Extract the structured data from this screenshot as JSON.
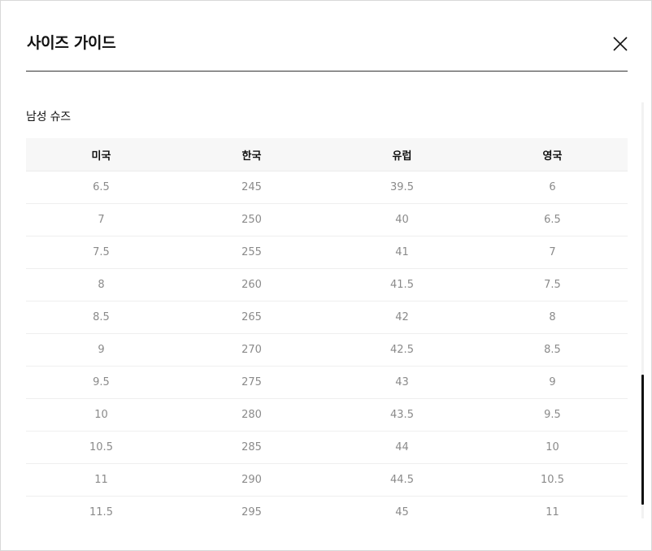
{
  "modal": {
    "title": "사이즈 가이드",
    "close_icon": "close-icon"
  },
  "section": {
    "title": "남성 슈즈"
  },
  "table": {
    "headers": [
      "미국",
      "한국",
      "유럽",
      "영국"
    ],
    "rows": [
      [
        "6.5",
        "245",
        "39.5",
        "6"
      ],
      [
        "7",
        "250",
        "40",
        "6.5"
      ],
      [
        "7.5",
        "255",
        "41",
        "7"
      ],
      [
        "8",
        "260",
        "41.5",
        "7.5"
      ],
      [
        "8.5",
        "265",
        "42",
        "8"
      ],
      [
        "9",
        "270",
        "42.5",
        "8.5"
      ],
      [
        "9.5",
        "275",
        "43",
        "9"
      ],
      [
        "10",
        "280",
        "43.5",
        "9.5"
      ],
      [
        "10.5",
        "285",
        "44",
        "10"
      ],
      [
        "11",
        "290",
        "44.5",
        "10.5"
      ],
      [
        "11.5",
        "295",
        "45",
        "11"
      ]
    ]
  }
}
